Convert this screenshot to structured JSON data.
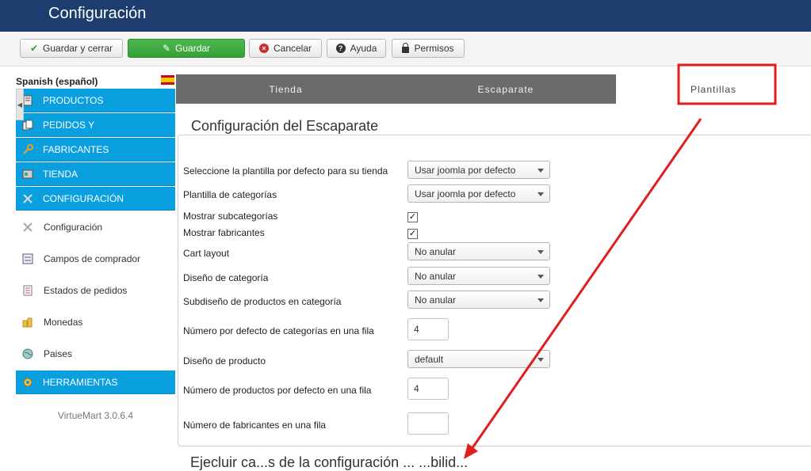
{
  "header": {
    "title": "Configuración"
  },
  "toolbar": {
    "save_close": "Guardar y cerrar",
    "save": "Guardar",
    "cancel": "Cancelar",
    "help": "Ayuda",
    "permissions": "Permisos"
  },
  "sidebar": {
    "language": "Spanish (español)",
    "sections": {
      "productos": "PRODUCTOS",
      "pedidos": "PEDIDOS Y",
      "fabricantes": "FABRICANTES",
      "tienda": "TIENDA",
      "configuracion": "CONFIGURACIÓN",
      "herramientas": "HERRAMIENTAS"
    },
    "sub": {
      "configuracion": "Configuración",
      "campos": "Campos de comprador",
      "estados": "Estados de pedidos",
      "monedas": "Monedas",
      "paises": "Paises"
    },
    "version": "VirtueMart 3.0.6.4"
  },
  "tabs": {
    "tienda": "Tienda",
    "escaparate": "Escaparate",
    "plantillas": "Plantillas"
  },
  "form": {
    "legend": "Configuración del Escaparate",
    "labels": {
      "default_template": "Seleccione la plantilla por defecto para su tienda",
      "category_template": "Plantilla de categorías",
      "show_subcats": "Mostrar subcategorías",
      "show_manufacturers": "Mostrar fabricantes",
      "cart_layout": "Cart layout",
      "category_layout": "Diseño de categoría",
      "category_sublayout": "Subdiseño de productos en categoría",
      "cats_per_row": "Número por defecto de categorías en una fila",
      "product_layout": "Diseño de producto",
      "products_per_row": "Número de productos por defecto en una fila",
      "manufacturers_per_row": "Número de fabricantes en una fila"
    },
    "values": {
      "default_template": "Usar joomla por defecto",
      "category_template": "Usar joomla por defecto",
      "show_subcats": "✓",
      "show_manufacturers": "✓",
      "cart_layout": "No anular",
      "category_layout": "No anular",
      "category_sublayout": "No anular",
      "cats_per_row": "4",
      "product_layout": "default",
      "products_per_row": "4",
      "manufacturers_per_row": ""
    }
  },
  "footer_cut": "Ejecluir ca...s de la configuración ... ...bilid...",
  "colors": {
    "header": "#1c3d6e",
    "sidebar_blue": "#0aa0df",
    "annotation": "#e01e1e",
    "save_green": "#3aa83a"
  },
  "icons": [
    "check-icon",
    "edit-icon",
    "cancel-icon",
    "help-icon",
    "lock-icon",
    "spain-flag-icon",
    "products-icon",
    "orders-icon",
    "wrench-icon",
    "shop-icon",
    "config-icon",
    "fields-icon",
    "order-status-icon",
    "coins-icon",
    "globe-icon",
    "tools-icon"
  ]
}
